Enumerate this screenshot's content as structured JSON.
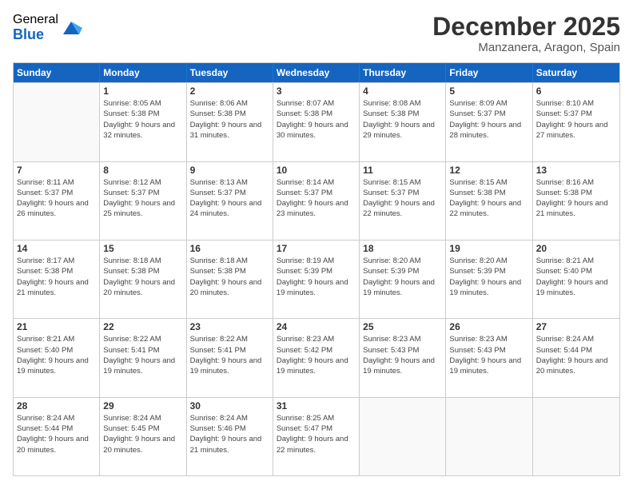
{
  "logo": {
    "general": "General",
    "blue": "Blue"
  },
  "title": "December 2025",
  "location": "Manzanera, Aragon, Spain",
  "days_header": [
    "Sunday",
    "Monday",
    "Tuesday",
    "Wednesday",
    "Thursday",
    "Friday",
    "Saturday"
  ],
  "weeks": [
    [
      {
        "day": "",
        "empty": true
      },
      {
        "day": "1",
        "sunrise": "8:05 AM",
        "sunset": "5:38 PM",
        "daylight": "9 hours and 32 minutes."
      },
      {
        "day": "2",
        "sunrise": "8:06 AM",
        "sunset": "5:38 PM",
        "daylight": "9 hours and 31 minutes."
      },
      {
        "day": "3",
        "sunrise": "8:07 AM",
        "sunset": "5:38 PM",
        "daylight": "9 hours and 30 minutes."
      },
      {
        "day": "4",
        "sunrise": "8:08 AM",
        "sunset": "5:38 PM",
        "daylight": "9 hours and 29 minutes."
      },
      {
        "day": "5",
        "sunrise": "8:09 AM",
        "sunset": "5:37 PM",
        "daylight": "9 hours and 28 minutes."
      },
      {
        "day": "6",
        "sunrise": "8:10 AM",
        "sunset": "5:37 PM",
        "daylight": "9 hours and 27 minutes."
      }
    ],
    [
      {
        "day": "7",
        "sunrise": "8:11 AM",
        "sunset": "5:37 PM",
        "daylight": "9 hours and 26 minutes."
      },
      {
        "day": "8",
        "sunrise": "8:12 AM",
        "sunset": "5:37 PM",
        "daylight": "9 hours and 25 minutes."
      },
      {
        "day": "9",
        "sunrise": "8:13 AM",
        "sunset": "5:37 PM",
        "daylight": "9 hours and 24 minutes."
      },
      {
        "day": "10",
        "sunrise": "8:14 AM",
        "sunset": "5:37 PM",
        "daylight": "9 hours and 23 minutes."
      },
      {
        "day": "11",
        "sunrise": "8:15 AM",
        "sunset": "5:37 PM",
        "daylight": "9 hours and 22 minutes."
      },
      {
        "day": "12",
        "sunrise": "8:15 AM",
        "sunset": "5:38 PM",
        "daylight": "9 hours and 22 minutes."
      },
      {
        "day": "13",
        "sunrise": "8:16 AM",
        "sunset": "5:38 PM",
        "daylight": "9 hours and 21 minutes."
      }
    ],
    [
      {
        "day": "14",
        "sunrise": "8:17 AM",
        "sunset": "5:38 PM",
        "daylight": "9 hours and 21 minutes."
      },
      {
        "day": "15",
        "sunrise": "8:18 AM",
        "sunset": "5:38 PM",
        "daylight": "9 hours and 20 minutes."
      },
      {
        "day": "16",
        "sunrise": "8:18 AM",
        "sunset": "5:38 PM",
        "daylight": "9 hours and 20 minutes."
      },
      {
        "day": "17",
        "sunrise": "8:19 AM",
        "sunset": "5:39 PM",
        "daylight": "9 hours and 19 minutes."
      },
      {
        "day": "18",
        "sunrise": "8:20 AM",
        "sunset": "5:39 PM",
        "daylight": "9 hours and 19 minutes."
      },
      {
        "day": "19",
        "sunrise": "8:20 AM",
        "sunset": "5:39 PM",
        "daylight": "9 hours and 19 minutes."
      },
      {
        "day": "20",
        "sunrise": "8:21 AM",
        "sunset": "5:40 PM",
        "daylight": "9 hours and 19 minutes."
      }
    ],
    [
      {
        "day": "21",
        "sunrise": "8:21 AM",
        "sunset": "5:40 PM",
        "daylight": "9 hours and 19 minutes."
      },
      {
        "day": "22",
        "sunrise": "8:22 AM",
        "sunset": "5:41 PM",
        "daylight": "9 hours and 19 minutes."
      },
      {
        "day": "23",
        "sunrise": "8:22 AM",
        "sunset": "5:41 PM",
        "daylight": "9 hours and 19 minutes."
      },
      {
        "day": "24",
        "sunrise": "8:23 AM",
        "sunset": "5:42 PM",
        "daylight": "9 hours and 19 minutes."
      },
      {
        "day": "25",
        "sunrise": "8:23 AM",
        "sunset": "5:43 PM",
        "daylight": "9 hours and 19 minutes."
      },
      {
        "day": "26",
        "sunrise": "8:23 AM",
        "sunset": "5:43 PM",
        "daylight": "9 hours and 19 minutes."
      },
      {
        "day": "27",
        "sunrise": "8:24 AM",
        "sunset": "5:44 PM",
        "daylight": "9 hours and 20 minutes."
      }
    ],
    [
      {
        "day": "28",
        "sunrise": "8:24 AM",
        "sunset": "5:44 PM",
        "daylight": "9 hours and 20 minutes."
      },
      {
        "day": "29",
        "sunrise": "8:24 AM",
        "sunset": "5:45 PM",
        "daylight": "9 hours and 20 minutes."
      },
      {
        "day": "30",
        "sunrise": "8:24 AM",
        "sunset": "5:46 PM",
        "daylight": "9 hours and 21 minutes."
      },
      {
        "day": "31",
        "sunrise": "8:25 AM",
        "sunset": "5:47 PM",
        "daylight": "9 hours and 22 minutes."
      },
      {
        "day": "",
        "empty": true
      },
      {
        "day": "",
        "empty": true
      },
      {
        "day": "",
        "empty": true
      }
    ]
  ]
}
